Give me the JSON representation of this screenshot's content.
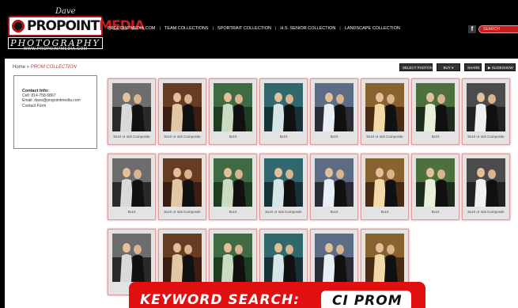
{
  "header": {
    "logo_signature": "Dave Corbert",
    "logo_brand_part1": "PRO",
    "logo_brand_part2": "POINT",
    "logo_brand_part3": "MEDIA",
    "logo_photography": "PHOTOGRAPHY",
    "logo_url": "WWW.PROPOINTMEDIA.COM",
    "nav": [
      "PROPOINTMEDIA.COM",
      "TEAM COLLECTIONS",
      "SPORTRAIT COLLECTION",
      "H.S. SENIOR COLLECTION",
      "LANDSCAPE COLLECTION"
    ],
    "facebook_glyph": "f",
    "search_placeholder": "SEARCH"
  },
  "breadcrumb": {
    "home": "Home",
    "separator": " » ",
    "current": "PROM COLLECTION"
  },
  "actions": {
    "select_photos": "SELECT PHOTOS",
    "buy": "BUY ▾",
    "share": "SHARE",
    "slideshow": "▶ SLIDESHOW"
  },
  "contact": {
    "heading": "Contact Info:",
    "cell": "Cell: 814-758-5867",
    "email": "Email: dave@propointmedia.com",
    "form": "Contact Form"
  },
  "gallery": {
    "items": [
      {
        "caption": "8x10 or 4x5 Composite",
        "icon": "prom-photo-icon"
      },
      {
        "caption": "8x10 or 4x5 Composite",
        "icon": "prom-photo-icon"
      },
      {
        "caption": "8x10",
        "icon": "prom-photo-icon"
      },
      {
        "caption": "8x10",
        "icon": "prom-photo-icon"
      },
      {
        "caption": "8x10",
        "icon": "prom-photo-icon"
      },
      {
        "caption": "8x10 or 4x5 Composite",
        "icon": "prom-photo-icon"
      },
      {
        "caption": "8x10",
        "icon": "prom-photo-icon"
      },
      {
        "caption": "8x10 or 4x5 Composite",
        "icon": "prom-photo-icon"
      },
      {
        "caption": "8x10",
        "icon": "prom-photo-icon"
      },
      {
        "caption": "8x10 or 4x5 Composite",
        "icon": "prom-photo-icon"
      },
      {
        "caption": "8x10",
        "icon": "prom-photo-icon"
      },
      {
        "caption": "8x10 or 4x5 Composite",
        "icon": "prom-photo-icon"
      },
      {
        "caption": "8x10",
        "icon": "prom-photo-icon"
      },
      {
        "caption": "8x10",
        "icon": "prom-photo-icon"
      },
      {
        "caption": "8x10",
        "icon": "prom-photo-icon"
      },
      {
        "caption": "8x10 or 4x5 Composite",
        "icon": "prom-photo-icon"
      },
      {
        "caption": "",
        "icon": "prom-photo-icon"
      },
      {
        "caption": "",
        "icon": "prom-photo-icon"
      },
      {
        "caption": "",
        "icon": "prom-photo-icon"
      },
      {
        "caption": "",
        "icon": "prom-photo-icon"
      },
      {
        "caption": "",
        "icon": "prom-photo-icon"
      },
      {
        "caption": "",
        "icon": "prom-photo-icon"
      }
    ]
  },
  "keyword_banner": {
    "label": "KEYWORD SEARCH:",
    "value": "CI PROM"
  },
  "colors": {
    "brand_red": "#c41e1e",
    "banner_red": "#e10f0f",
    "header_bg": "#000000"
  }
}
